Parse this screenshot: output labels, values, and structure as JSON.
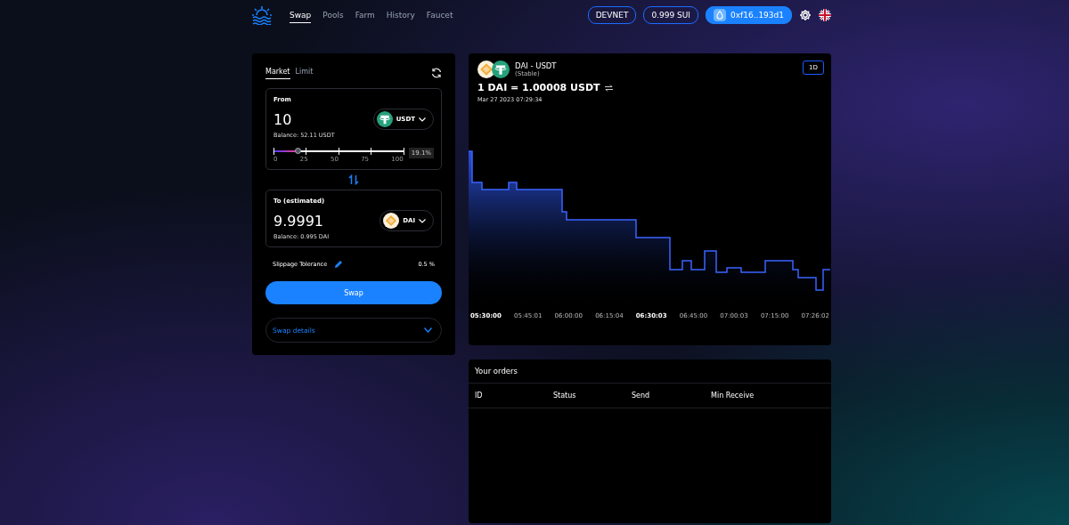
{
  "nav": {
    "links": [
      {
        "label": "Swap",
        "selected": true
      },
      {
        "label": "Pools",
        "selected": false
      },
      {
        "label": "Farm",
        "selected": false
      },
      {
        "label": "History",
        "selected": false
      },
      {
        "label": "Faucet",
        "selected": false
      }
    ],
    "network": "DEVNET",
    "balance": "0.999 SUI",
    "wallet": "0xf16..193d1"
  },
  "swap": {
    "tabs": [
      {
        "label": "Market",
        "selected": true
      },
      {
        "label": "Limit",
        "selected": false
      }
    ],
    "from": {
      "label": "From",
      "amount": "10",
      "token": "USDT",
      "kind": "usdt",
      "balance": "Balance: 52.11 USDT",
      "level": 0.191,
      "percent": "19.1%",
      "ticks": [
        "0",
        "25",
        "50",
        "75",
        "100"
      ]
    },
    "to": {
      "label": "To (estimated)",
      "amount": "9.9991",
      "token": "DAI",
      "kind": "dai",
      "balance": "Balance: 0.995 DAI"
    },
    "slippage_label": "Slippage Tolerance",
    "slippage_value": "0.5 %",
    "swap_button": "Swap",
    "details": "Swap details"
  },
  "chart": {
    "pair": "DAI - USDT",
    "pool_type": "(Stable)",
    "rate": "1 DAI = 1.00008 USDT",
    "timestamp": "Mar 27 2023 07:29:34",
    "range_button": "1D",
    "x_labels": [
      {
        "text": "05:30:00",
        "bold": true
      },
      {
        "text": "05:45:01",
        "bold": false
      },
      {
        "text": "06:00:00",
        "bold": false
      },
      {
        "text": "06:15:04",
        "bold": false
      },
      {
        "text": "06:30:03",
        "bold": true
      },
      {
        "text": "06:45:00",
        "bold": false
      },
      {
        "text": "07:00:03",
        "bold": false
      },
      {
        "text": "07:15:00",
        "bold": false
      },
      {
        "text": "07:26:02",
        "bold": false
      }
    ]
  },
  "orders": {
    "title": "Your orders",
    "columns": [
      "ID",
      "Status",
      "Send",
      "Min Receive"
    ]
  }
}
